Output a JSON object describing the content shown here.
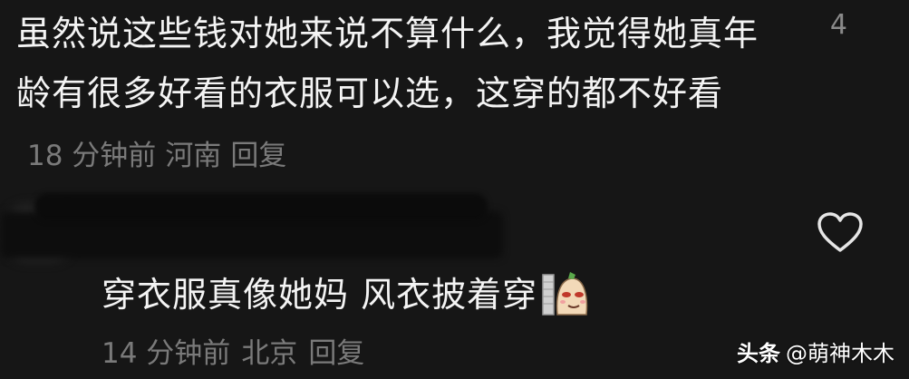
{
  "comment1": {
    "text": "虽然说这些钱对她来说不算什么，我觉得她真年龄有很多好看的衣服可以选，这穿的都不好看",
    "time": "18 分钟前",
    "location": "河南",
    "reply_label": "回复",
    "like_count": "4"
  },
  "comment2": {
    "text": "穿衣服真像她妈 风衣披着穿",
    "time": "14 分钟前",
    "location": "北京",
    "reply_label": "回复",
    "like_icon": "heart-outline-icon"
  },
  "watermark": {
    "brand": "头条",
    "handle": "@萌神木木"
  },
  "colors": {
    "background": "#161616",
    "text": "#f4f4f4",
    "meta": "#7a7a7a"
  }
}
